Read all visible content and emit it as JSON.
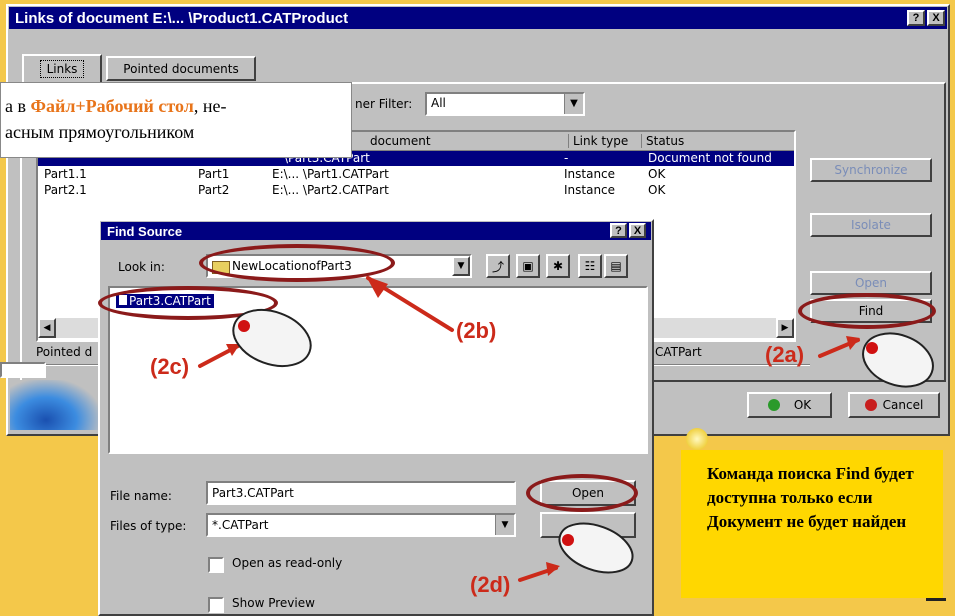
{
  "main_window": {
    "title": "Links of document E:\\... \\Product1.CATProduct",
    "help_btn": "?",
    "close_btn": "X",
    "tabs": [
      "Links",
      "Pointed documents"
    ],
    "filter_label": "ner Filter:",
    "filter_value": "All",
    "columns": [
      "document",
      "Link type",
      "Status"
    ],
    "rows": [
      {
        "name": "",
        "part": "",
        "doc": "\\Part3.CATPart",
        "type": "-",
        "status": "Document not found"
      },
      {
        "name": "Part1.1",
        "part": "Part1",
        "doc": "E:\\... \\Part1.CATPart",
        "type": "Instance",
        "status": "OK"
      },
      {
        "name": "Part2.1",
        "part": "Part2",
        "doc": "E:\\... \\Part2.CATPart",
        "type": "Instance",
        "status": "OK"
      }
    ],
    "buttons": {
      "synchronize": "Synchronize",
      "isolate": "Isolate",
      "open": "Open",
      "find": "Find",
      "ok": "OK",
      "cancel": "Cancel"
    },
    "pointed_label": "Pointed d",
    "pointed_value": "CATPart"
  },
  "note_top": {
    "prefix": "а в ",
    "highlight": "Файл+Рабочий стол",
    "line1_suffix": ", не-",
    "line2": "асным прямоугольником"
  },
  "find_dialog": {
    "title": "Find Source",
    "help_btn": "?",
    "close_btn": "X",
    "look_in_label": "Look in:",
    "look_in_value": "NewLocationofPart3",
    "file_item": "Part3.CATPart",
    "file_name_label": "File name:",
    "file_name_value": "Part3.CATPart",
    "files_type_label": "Files of type:",
    "files_type_value": "*.CATPart",
    "open_button": "Open",
    "open_readonly": "Open as read-only",
    "show_preview": "Show Preview"
  },
  "callouts": {
    "c2a": "(2a)",
    "c2b": "(2b)",
    "c2c": "(2c)",
    "c2d": "(2d)"
  },
  "note_box": {
    "text": "Команда поиска Find будет доступна только если Документ не будет найден"
  },
  "colors": {
    "accent_red": "#cc2a1a",
    "ellipse": "#8b1a1a",
    "titlebar": "#000080",
    "note_bg": "#ffd700"
  }
}
